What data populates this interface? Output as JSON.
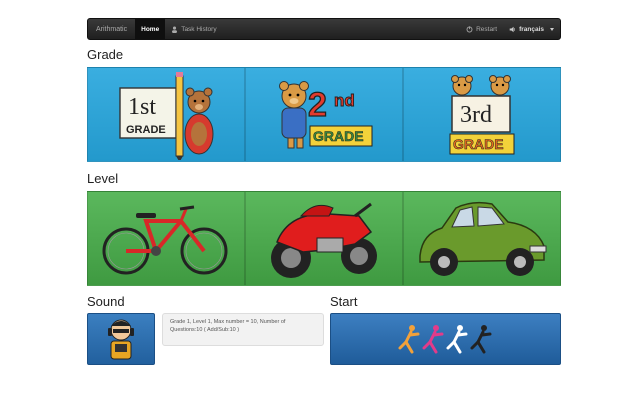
{
  "navbar": {
    "brand": "Arithmatic",
    "home": "Home",
    "task_history": "Task History",
    "restart": "Restart",
    "language": "français"
  },
  "sections": {
    "grade": "Grade",
    "level": "Level",
    "sound": "Sound",
    "start": "Start"
  },
  "grade_cards": [
    {
      "label": "1st",
      "sub": "GRADE",
      "icon": "first-grade-bear-pencil-icon"
    },
    {
      "label": "2nd",
      "sub": "GRADE",
      "icon": "second-grade-bear-icon"
    },
    {
      "label": "3rd",
      "sub": "GRADE",
      "icon": "third-grade-bears-icon"
    }
  ],
  "level_cards": [
    {
      "icon": "bicycle-icon"
    },
    {
      "icon": "motorcycle-icon"
    },
    {
      "icon": "car-icon"
    }
  ],
  "summary": "Grade 1, Level 1, Max number = 10, Number of Questions:10 ( Add/Sub:10 )",
  "colors": {
    "grade_bg": "#2aa3d6",
    "level_bg": "#4caa4e",
    "start_bg": "#2b6dad"
  }
}
